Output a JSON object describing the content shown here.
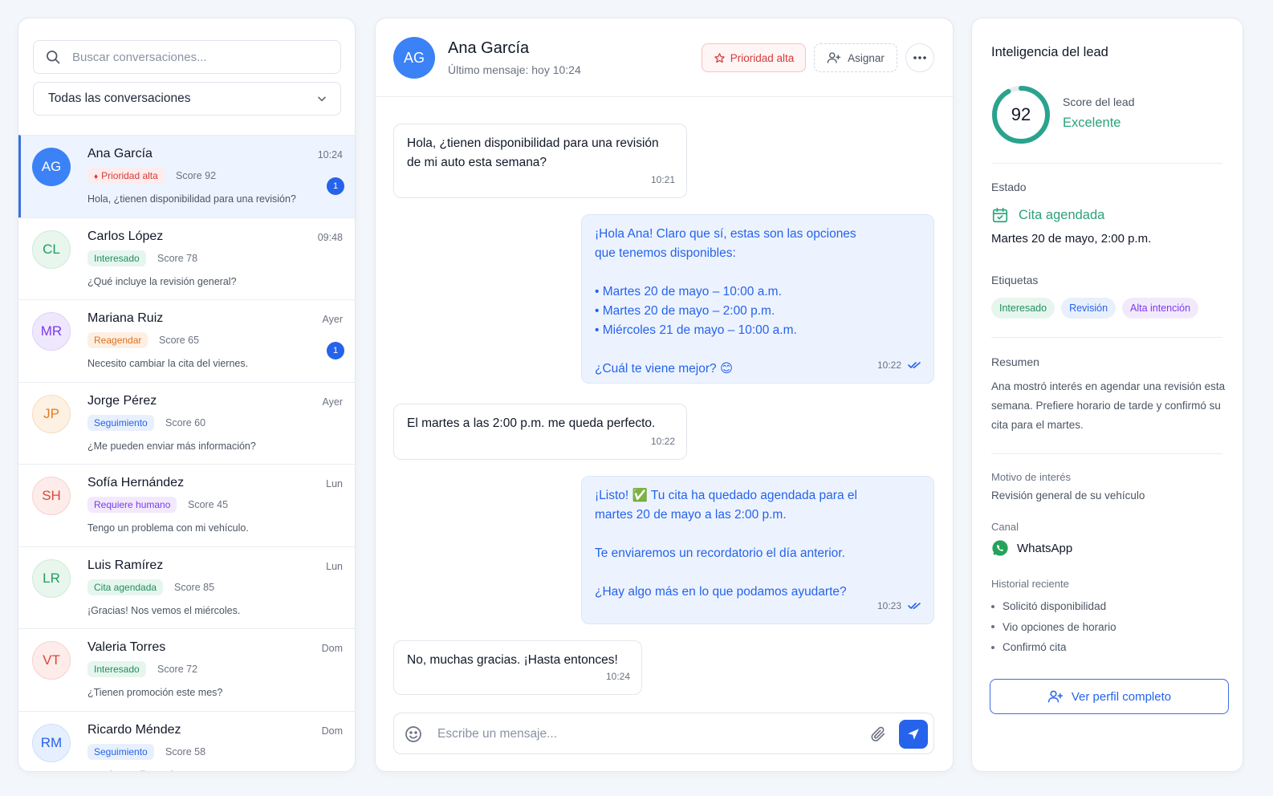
{
  "colors": {
    "accent": "#2563eb",
    "success": "#2aa37a",
    "danger": "#d33b3b"
  },
  "search": {
    "placeholder": "Buscar conversaciones..."
  },
  "filter": {
    "selected": "Todas las conversaciones"
  },
  "conversations": [
    {
      "initials": "AG",
      "name": "Ana García",
      "time": "10:24",
      "tag": "Prioridad alta",
      "tag_icon": "flame-icon",
      "tag_kind": "red",
      "score": "Score 92",
      "preview": "Hola, ¿tienen disponibilidad para una revisión?",
      "unread": "1",
      "avatar_kind": "blue-solid"
    },
    {
      "initials": "CL",
      "name": "Carlos López",
      "time": "09:48",
      "tag": "Interesado",
      "tag_kind": "green",
      "score": "Score 78",
      "preview": "¿Qué incluye la revisión general?",
      "unread": "",
      "avatar_kind": "green"
    },
    {
      "initials": "MR",
      "name": "Mariana Ruiz",
      "time": "Ayer",
      "tag": "Reagendar",
      "tag_kind": "orange",
      "score": "Score 65",
      "preview": "Necesito cambiar la cita del viernes.",
      "unread": "1",
      "avatar_kind": "purple"
    },
    {
      "initials": "JP",
      "name": "Jorge Pérez",
      "time": "Ayer",
      "tag": "Seguimiento",
      "tag_kind": "blue",
      "score": "Score 60",
      "preview": "¿Me pueden enviar más información?",
      "unread": "",
      "avatar_kind": "orange"
    },
    {
      "initials": "SH",
      "name": "Sofía Hernández",
      "time": "Lun",
      "tag": "Requiere humano",
      "tag_kind": "purple",
      "score": "Score 45",
      "preview": "Tengo un problema con mi vehículo.",
      "unread": "",
      "avatar_kind": "red"
    },
    {
      "initials": "LR",
      "name": "Luis Ramírez",
      "time": "Lun",
      "tag": "Cita agendada",
      "tag_kind": "green",
      "score": "Score 85",
      "preview": "¡Gracias! Nos vemos el miércoles.",
      "unread": "",
      "avatar_kind": "green"
    },
    {
      "initials": "VT",
      "name": "Valeria Torres",
      "time": "Dom",
      "tag": "Interesado",
      "tag_kind": "green",
      "score": "Score 72",
      "preview": "¿Tienen promoción este mes?",
      "unread": "",
      "avatar_kind": "red"
    },
    {
      "initials": "RM",
      "name": "Ricardo Méndez",
      "time": "Dom",
      "tag": "Seguimiento",
      "tag_kind": "blue",
      "score": "Score 58",
      "preview": "Quedo pendiente de su respuesta.",
      "unread": "",
      "avatar_kind": "blue"
    }
  ],
  "chat": {
    "initials": "AG",
    "name": "Ana García",
    "last_message": "Último mensaje: hoy 10:24",
    "priority_label": "Prioridad alta",
    "assign_label": "Asignar",
    "messages": [
      {
        "dir": "in",
        "text": "Hola, ¿tienen disponibilidad para una revisión\nde mi auto esta semana?",
        "time": "10:21"
      },
      {
        "dir": "out",
        "text": "¡Hola Ana! Claro que sí, estas son las opciones\nque tenemos disponibles:\n\n• Martes 20 de mayo – 10:00 a.m.\n• Martes 20 de mayo – 2:00 p.m.\n• Miércoles 21 de mayo – 10:00 a.m.\n\n¿Cuál te viene mejor? 😊",
        "time": "10:22"
      },
      {
        "dir": "in",
        "text": "El martes a las 2:00 p.m. me queda perfecto.",
        "time": "10:22"
      },
      {
        "dir": "out",
        "text": "¡Listo! ✅ Tu cita ha quedado agendada para el\nmartes 20 de mayo a las 2:00 p.m.\n\nTe enviaremos un recordatorio el día anterior.\n\n¿Hay algo más en lo que podamos ayudarte?",
        "time": "10:23"
      },
      {
        "dir": "in",
        "text": "No, muchas gracias. ¡Hasta entonces!",
        "time": "10:24"
      }
    ],
    "composer_placeholder": "Escribe un mensaje..."
  },
  "lead": {
    "title": "Inteligencia del lead",
    "score": "92",
    "score_fraction": 0.92,
    "score_label": "Score del lead",
    "score_value": "Excelente",
    "estado_label": "Estado",
    "estado_value": "Cita agendada",
    "estado_date": "Martes 20 de mayo, 2:00 p.m.",
    "etiquetas_label": "Etiquetas",
    "tags": [
      "Interesado",
      "Revisión",
      "Alta intención"
    ],
    "resumen_label": "Resumen",
    "resumen": "Ana mostró interés en agendar una revisión esta semana. Prefiere horario de tarde y confirmó su cita para el martes.",
    "motivo_label": "Motivo de interés",
    "motivo_value": "Revisión general de su vehículo",
    "canal_label": "Canal",
    "canal_value": "WhatsApp",
    "historial_label": "Historial reciente",
    "historial": [
      "Solicitó disponibilidad",
      "Vio opciones de horario",
      "Confirmó cita"
    ],
    "profile_button": "Ver perfil completo"
  }
}
